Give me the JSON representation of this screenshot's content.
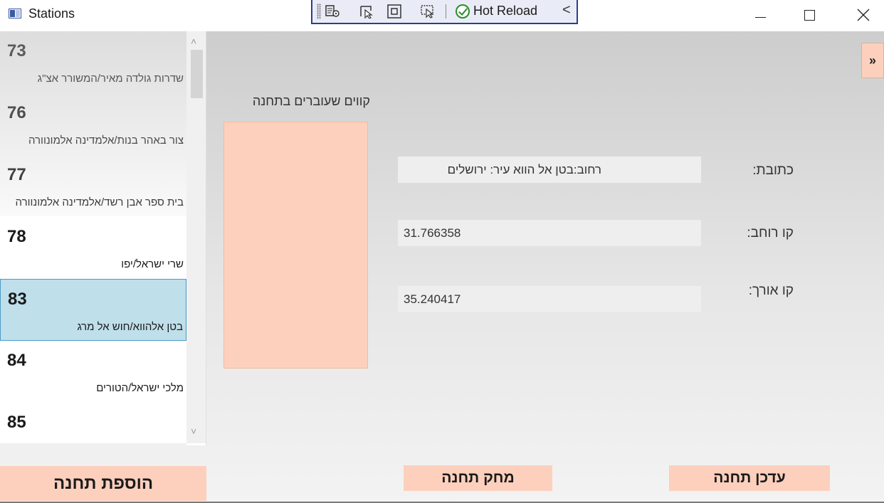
{
  "window": {
    "title": "Stations",
    "icons": {
      "app": "window-app-icon",
      "minimize": "minimize-icon",
      "maximize": "maximize-icon",
      "close": "close-icon"
    }
  },
  "debug_toolbar": {
    "icons": [
      "select-element-icon",
      "pointer-icon",
      "layout-adorner-icon",
      "track-focus-icon"
    ],
    "hot_reload_label": "Hot Reload",
    "check_icon": "check-circle-icon",
    "collapse_glyph": "<"
  },
  "stations": [
    {
      "number": "73",
      "name": "שדרות גולדה מאיר/המשורר אצ\"ג"
    },
    {
      "number": "76",
      "name": "צור באהר בנות/אלמדינה אלמונוורה"
    },
    {
      "number": "77",
      "name": "בית ספר אבן רשד/אלמדינה אלמונוורה"
    },
    {
      "number": "78",
      "name": "שרי ישראל/יפו"
    },
    {
      "number": "83",
      "name": "בטן אלהווא/חוש אל מרג"
    },
    {
      "number": "84",
      "name": "מלכי ישראל/הטורים"
    },
    {
      "number": "85",
      "name": ""
    }
  ],
  "selected_station_index": 4,
  "scroll": {
    "up": "˄",
    "down": "˅",
    "left": "<",
    "right": ">"
  },
  "buttons": {
    "add_station": "הוספת תחנה",
    "delete_station": "מחק תחנה",
    "update_station": "עדכן תחנה",
    "side_toggle": "»"
  },
  "lines_label": "קווים שעוברים בתחנה",
  "details": {
    "address_label": "כתובת:",
    "address_value": "רחוב:בטן אל הווא  עיר: ירושלים",
    "latitude_label": "קו רוחב:",
    "latitude_value": "31.766358",
    "longitude_label": "קו אורך:",
    "longitude_value": "35.240417"
  },
  "colors": {
    "accent": "#fcd0bd",
    "selection": "#bfdfea",
    "selection_border": "#4a9bc8"
  }
}
